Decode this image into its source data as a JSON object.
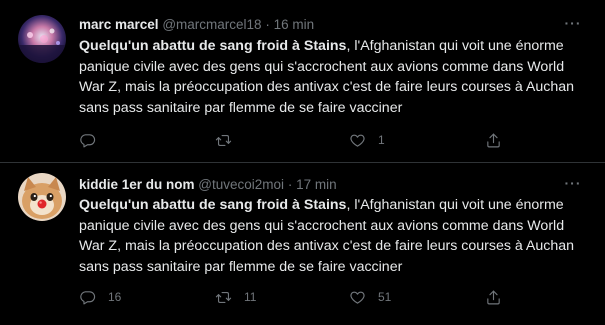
{
  "tweets": [
    {
      "name": "marc marcel",
      "handle": "@marcmarcel18",
      "separator": "·",
      "time": "16 min",
      "text_bold": "Quelqu'un abattu de sang froid à Stains",
      "text_rest": ", l'Afghanistan qui voit une énorme panique civile avec des gens qui s'accrochent aux avions comme dans World War Z, mais la préoccupation des antivax c'est de faire leurs courses à Auchan sans pass sanitaire par flemme de se faire vacciner",
      "replies": "",
      "retweets": "",
      "likes": "1"
    },
    {
      "name": "kiddie 1er du nom",
      "handle": "@tuvecoi2moi",
      "separator": "·",
      "time": "17 min",
      "text_bold": "Quelqu'un abattu de sang froid à Stains",
      "text_rest": ", l'Afghanistan qui voit une énorme panique civile avec des gens qui s'accrochent aux avions comme dans World War Z, mais la préoccupation des antivax c'est de faire leurs courses à Auchan sans pass sanitaire par flemme de se faire vacciner",
      "replies": "16",
      "retweets": "11",
      "likes": "51"
    }
  ],
  "icons": {
    "more": "more-icon",
    "reply": "reply-icon",
    "retweet": "retweet-icon",
    "like": "heart-icon",
    "share": "share-icon"
  },
  "colors": {
    "background": "#000000",
    "text": "#e7e9ea",
    "muted": "#71767b",
    "divider": "#2f3336"
  }
}
